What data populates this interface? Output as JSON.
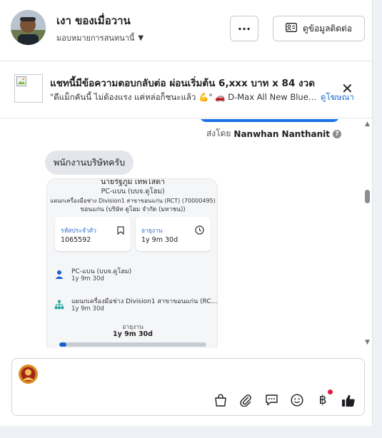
{
  "header": {
    "contact_name": "เงา ของเมื่อวาน",
    "assign_label": "มอบหมายการสนทนานี้",
    "more_label": "···",
    "contact_info_label": "ดูข้อมูลติดต่อ"
  },
  "ad": {
    "title": "แชทนี้มีข้อความตอบกลับต่อ ผ่อนเริ่มต้น 6,xxx บาท x 84 งวด",
    "body": "\"ดีแม็กคันนี้ ไม่ต้องแรง แค่หล่อก็ชนะแล้ว 💪\" 🚗 D-Max All New Blue P...",
    "link": "ดูโฆษณา"
  },
  "chat": {
    "sent_by_prefix": "ส่งโดย",
    "sent_by_name": "Nanwhan Nanthanit",
    "message": "พนักงานบริษัทครับ",
    "card": {
      "employee_name": "นายรัฐภูมิ เทพโสดา",
      "position": "PC-แบน (บบจ.ดูโฮม)",
      "department_line": "แผนกเครื่องมือช่าง Division1 สาขาขอนแก่น (RCT) (70000495)",
      "company_line": "ขอนแก่น (บริษัท ดูโฮม จำกัด (มหาชน))",
      "employee_id_label": "รหัสประจำตัว",
      "employee_id": "1065592",
      "age_label": "อายุงาน",
      "age_value": "1y 9m 30d",
      "row1_title": "PC-แบน (บบจ.ดูโฮม)",
      "row1_sub": "1y 9m 30d",
      "row2_title": "แผนกเครื่องมือช่าง Division1 สาขาขอนแก่น (RC...",
      "row2_sub": "1y 9m 30d",
      "tenure_label": "อายุงาน",
      "tenure_value": "1y 9m 30d",
      "tenure_progress": 0.05
    }
  },
  "composer": {
    "placeholder": "",
    "icons": [
      "shopping-bag-icon",
      "paperclip-icon",
      "quick-reply-icon",
      "emoji-icon",
      "baht-payment-icon",
      "thumbs-up-icon"
    ]
  },
  "colors": {
    "accent": "#1a73e8",
    "link": "#1a6dd6",
    "bubble": "#e4e6eb"
  }
}
